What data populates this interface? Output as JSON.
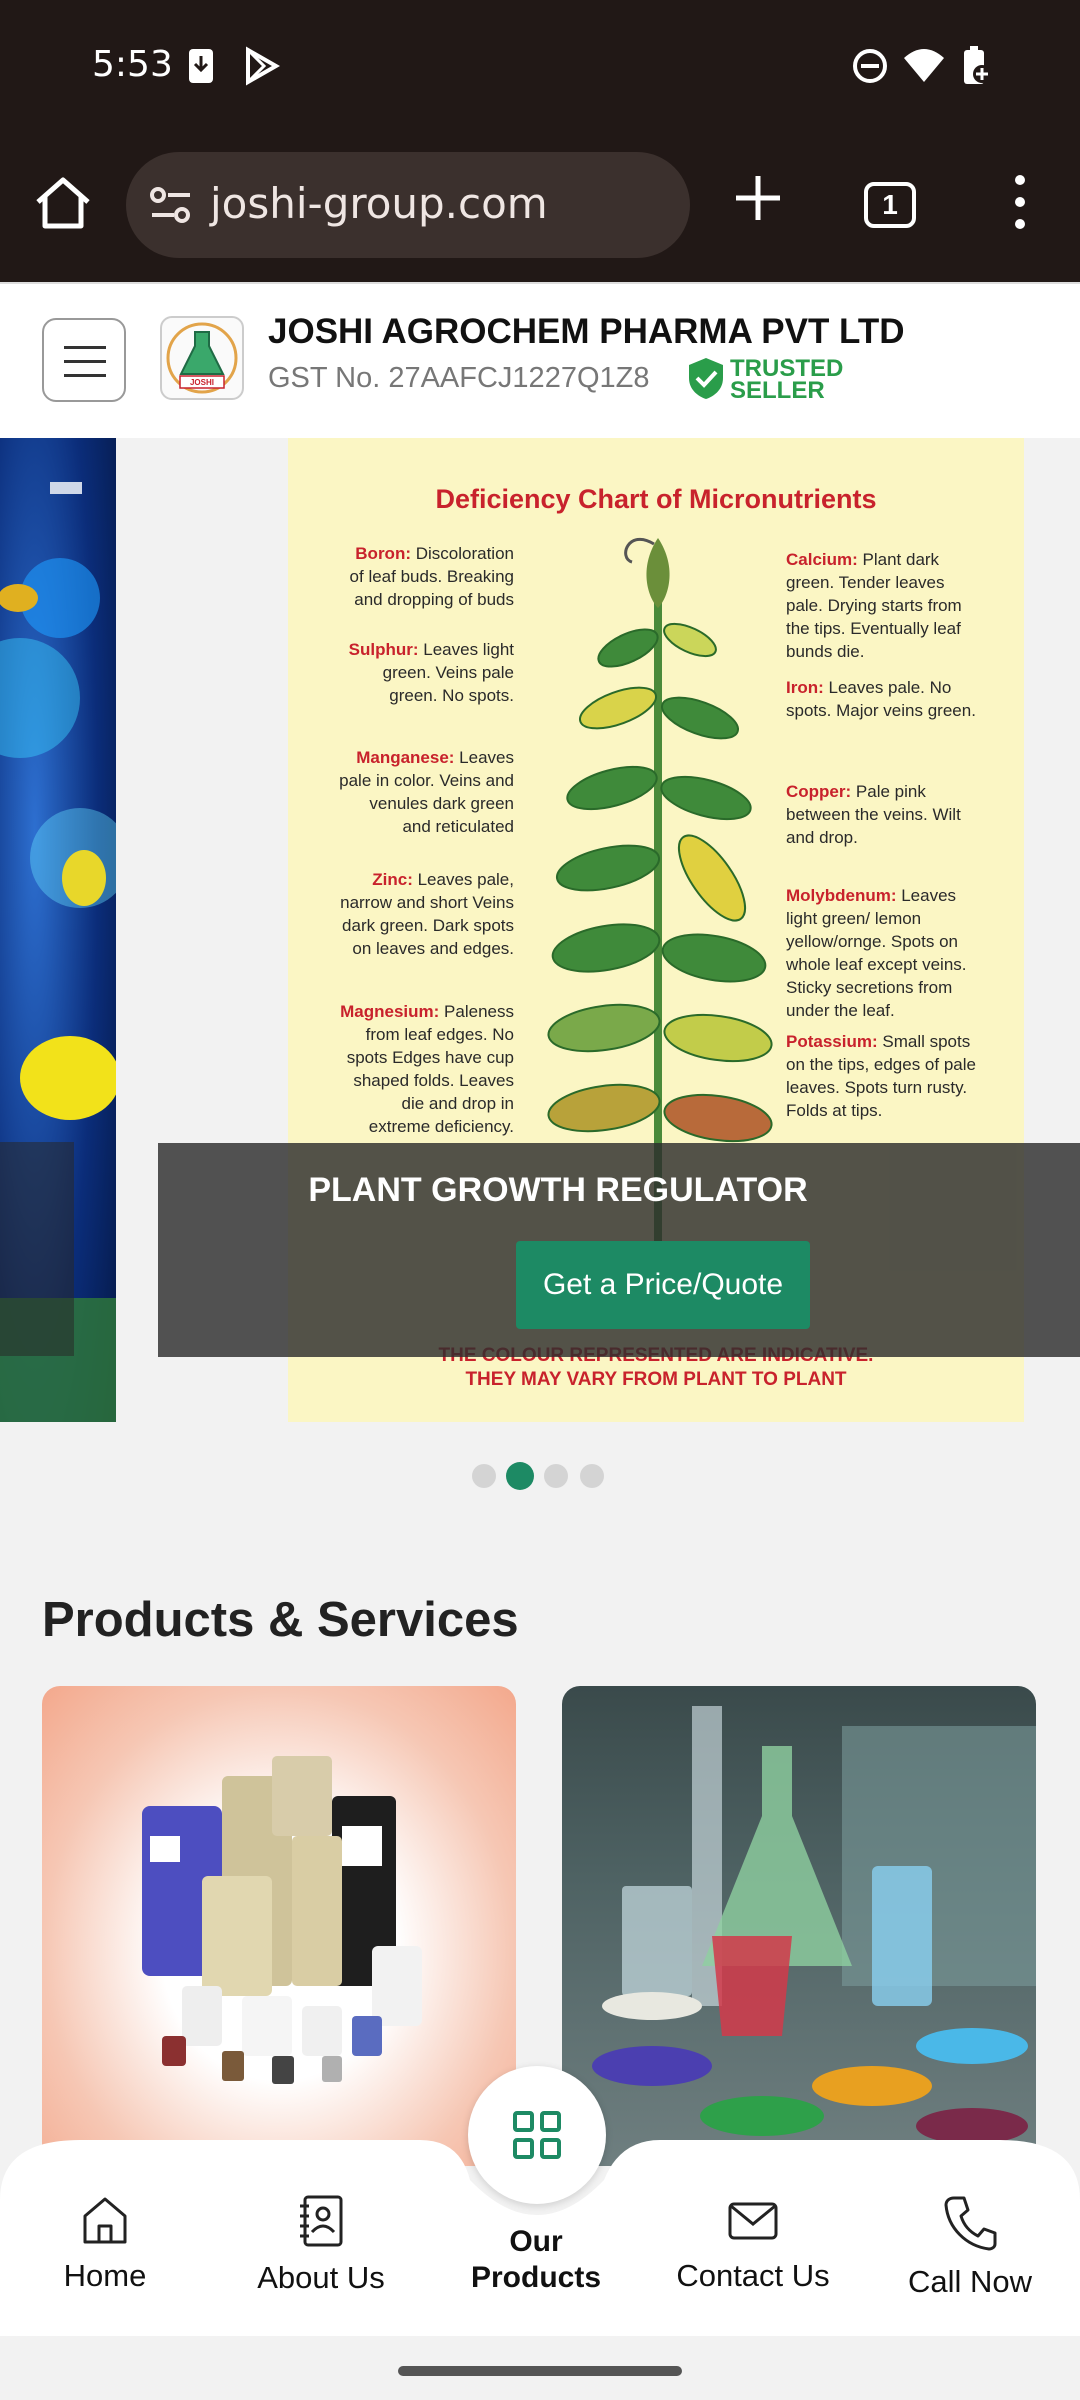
{
  "status_bar": {
    "time": "5:53"
  },
  "browser": {
    "url": "joshi-group.com",
    "tab_count": "1"
  },
  "header": {
    "company_name": "JOSHI AGROCHEM PHARMA PVT LTD",
    "gst": "GST No. 27AAFCJ1227Q1Z8",
    "trusted_line1": "TRUSTED",
    "trusted_line2": "SELLER",
    "logo_text": "JOSHI"
  },
  "carousel": {
    "chart": {
      "title": "Deficiency Chart of Micronutrients",
      "left_notes": [
        {
          "name": "Boron:",
          "text": " Discoloration of leaf buds. Breaking and dropping of buds"
        },
        {
          "name": "Sulphur:",
          "text": " Leaves light green. Veins pale green. No spots."
        },
        {
          "name": "Manganese:",
          "text": " Leaves pale in color. Veins and venules dark green and reticulated"
        },
        {
          "name": "Zinc:",
          "text": " Leaves pale, narrow and short Veins dark green. Dark spots on leaves and edges."
        },
        {
          "name": "Magnesium:",
          "text": " Paleness from leaf edges. No spots Edges have cup shaped folds. Leaves die and drop in extreme deficiency."
        }
      ],
      "right_notes": [
        {
          "name": "Calcium:",
          "text": " Plant dark green. Tender leaves pale. Drying starts from the tips. Eventually leaf bunds die."
        },
        {
          "name": "Iron:",
          "text": " Leaves pale. No spots. Major veins green."
        },
        {
          "name": "Copper:",
          "text": " Pale pink between the veins. Wilt and drop."
        },
        {
          "name": "Molybdenum:",
          "text": " Leaves light green/ lemon yellow/ornge. Spots on whole leaf except veins. Sticky secretions from under the leaf."
        },
        {
          "name": "Potassium:",
          "text": " Small spots on the tips, edges of pale leaves. Spots turn rusty. Folds at tips."
        }
      ],
      "disclaimer_line1": "THE COLOUR REPRESENTED ARE INDICATIVE.",
      "disclaimer_line2": "THEY MAY VARY FROM PLANT TO PLANT"
    },
    "caption": "PLANT GROWTH REGULATOR",
    "quote_button": "Get a Price/Quote",
    "active_slide": 2,
    "slide_count": 4
  },
  "products": {
    "title": "Products & Services"
  },
  "nav": {
    "home": "Home",
    "about": "About Us",
    "products_line1": "Our",
    "products_line2": "Products",
    "contact": "Contact Us",
    "call": "Call Now"
  },
  "colors": {
    "accent": "#1d8a64",
    "trusted": "#2a9d4a",
    "chrome": "#211816"
  }
}
